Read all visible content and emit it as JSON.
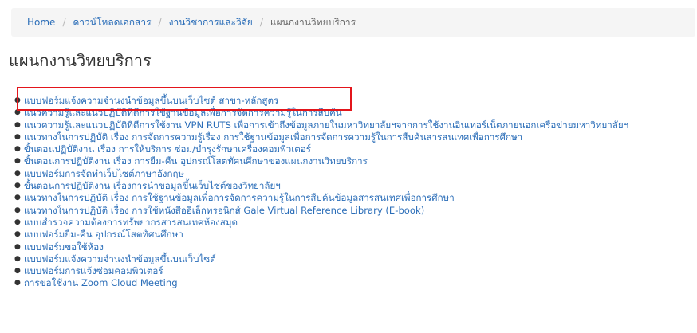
{
  "breadcrumb": {
    "home": "Home",
    "item1": "ดาวน์โหลดเอกสาร",
    "item2": "งานวิชาการและวิจัย",
    "current": "แผนกงานวิทยบริการ",
    "separator": "/"
  },
  "page_title": "แผนกงานวิทยบริการ",
  "links": [
    "แบบฟอร์มแจ้งความจำนงนำข้อมูลขึ้นบนเว็บไซต์  สาขา-หลักสูตร",
    "แนวความรู้และแนวปฏิบัติที่ดีการใช้ฐานข้อมูลเพื่อการจัดการความรู้ในการสืบค้น",
    "แนวความรู้และแนวปฏิบัติที่ดีการใช้งาน VPN RUTS เพื่อการเข้าถึงข้อมูลภายในมหาวิทยาลัยฯจากการใช้งานอินเทอร์เน็ตภายนอกเครือข่ายมหาวิทยาลัยฯ",
    "แนวทางในการปฏิบัติ เรื่อง การจัดการความรู้เรื่อง การใช้ฐานข้อมูลเพื่อการจัดการความรู้ในการสืบค้นสารสนเทศเพื่อการศึกษา",
    "ขั้นตอนปฏิบัติงาน เรื่อง การให้บริการ ซ่อม/บำรุงรักษาเครื่องคอมพิวเตอร์",
    "ขั้นตอนการปฏิบัติงาน เรื่อง การยืม-คืน อุปกรณ์โสตทัศนศึกษาของแผนกงานวิทยบริการ",
    "แบบฟอร์มการจัดทำเว็บไซต์ภาษาอังกฤษ",
    "ขั้นตอนการปฏิบัติงาน เรื่องการนำขอมูลขึ้นเว็บไซต์ของวิทยาลัยฯ",
    "แนวทางในการปฏิบัติ เรื่อง การใช้ฐานข้อมูลเพื่อการจัดการความรู้ในการสืบค้นข้อมูลสารสนเทศเพื่อการศึกษา",
    "แนวทางในการปฏิบัติ เรื่อง การใช้หนังสืออิเล็กทรอนิกส์ Gale Virtual Reference Library (E-book)",
    "แบบสำรวจความต้องการทรัพยากรสารสนเทศห้องสมุด",
    "แบบฟอร์มยืม-คืน อุปกรณ์โสตทัศนศึกษา",
    "แบบฟอร์มขอใช้ห้อง",
    "แบบฟอร์มแจ้งความจำนงนำข้อมูลขึ้นบนเว็บไซต์",
    "แบบฟอร์มการแจ้งซ่อมคอมพิวเตอร์",
    "การขอใช้งาน Zoom Cloud Meeting"
  ],
  "bullet": "●",
  "colors": {
    "link": "#2a6db8",
    "highlight": "#e3151b",
    "breadcrumb_bg": "#f5f5f5"
  }
}
